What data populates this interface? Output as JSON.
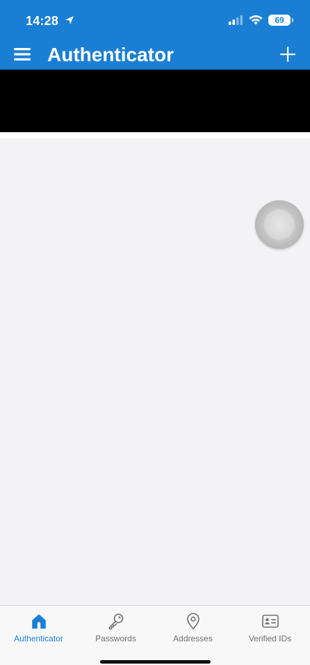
{
  "status_bar": {
    "time": "14:28",
    "battery": "69",
    "icons": [
      "location-arrow-icon",
      "signal-icon",
      "wifi-icon",
      "battery-icon"
    ]
  },
  "app_bar": {
    "title": "Authenticator",
    "menu_icon": "hamburger-menu-icon",
    "add_icon": "plus-icon"
  },
  "tabs": [
    {
      "label": "Authenticator",
      "icon": "home-icon",
      "active": true
    },
    {
      "label": "Passwords",
      "icon": "key-icon",
      "active": false
    },
    {
      "label": "Addresses",
      "icon": "location-pin-icon",
      "active": false
    },
    {
      "label": "Verified IDs",
      "icon": "id-card-icon",
      "active": false
    }
  ],
  "colors": {
    "brand": "#1a7fd4",
    "background": "#f3f2f5",
    "tab_inactive": "#6e6e73"
  }
}
